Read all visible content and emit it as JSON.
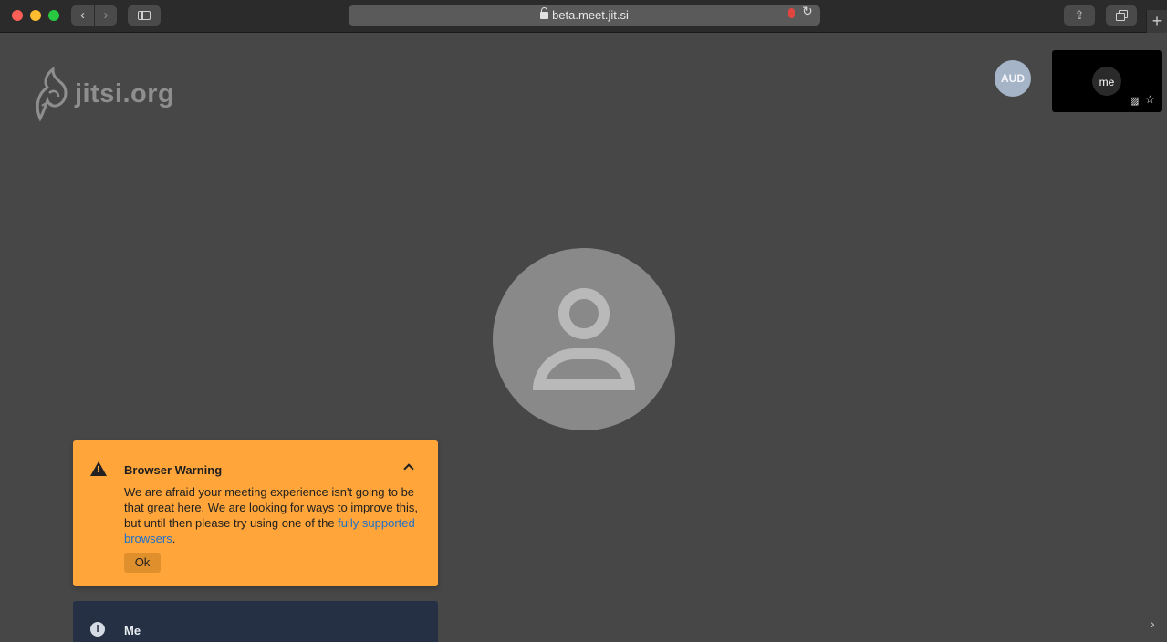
{
  "browser": {
    "url": "beta.meet.jit.si",
    "back_glyph": "‹",
    "forward_glyph": "›",
    "share_glyph": "⇪",
    "newtab_glyph": "+",
    "reload_glyph": "↻"
  },
  "meeting": {
    "logo_text": "jitsi.org",
    "audio_badge": "AUD",
    "self_view": {
      "avatar_text": "me",
      "camera_icon": "camera-off-icon",
      "star_icon": "star-icon",
      "star_glyph": "☆",
      "cam_glyph": "▨"
    }
  },
  "warning": {
    "title": "Browser Warning",
    "body_prefix": "We are afraid your meeting experience isn't going to be that great here. We are looking for ways to improve this, but until then please try using one of the ",
    "link_text": "fully supported browsers",
    "body_suffix": ".",
    "ok_label": "Ok",
    "icon_glyph": "!"
  },
  "info": {
    "title": "Me",
    "icon_glyph": "i"
  },
  "colors": {
    "warning_bg": "#ffa53a",
    "info_bg": "#253045",
    "stage_bg": "#474747",
    "link": "#1f70c9"
  },
  "scroll_glyph": "›"
}
